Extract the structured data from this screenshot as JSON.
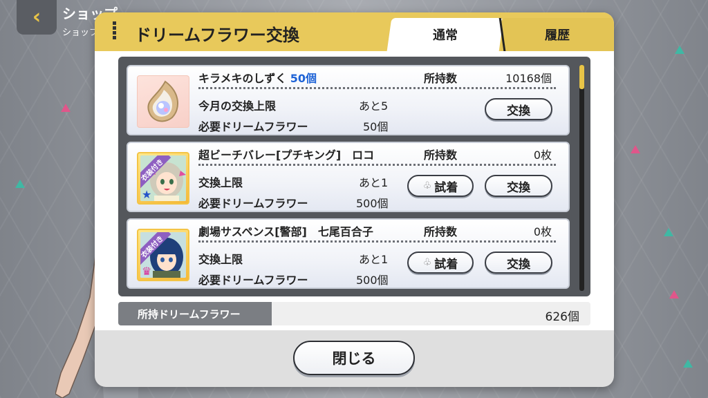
{
  "shop": {
    "title": "ショップ",
    "subtitle": "ショップ"
  },
  "modal": {
    "title": "ドリームフラワー交換",
    "tabs": [
      {
        "label": "通常",
        "active": true
      },
      {
        "label": "履歴",
        "active": false
      }
    ]
  },
  "items": [
    {
      "name": "キラメキのしずく",
      "quantity": "50個",
      "owned_label": "所持数",
      "owned_value": "10168個",
      "limit_label": "今月の交換上限",
      "limit_value": "あと5",
      "cost_label": "必要ドリームフラワー",
      "cost_value": "50個",
      "exchange_label": "交換",
      "icon": "crystal-drop-icon"
    },
    {
      "name": "超ビーチバレー[プチキング]　ロコ",
      "owned_label": "所持数",
      "owned_value": "0枚",
      "limit_label": "交換上限",
      "limit_value": "あと1",
      "cost_label": "必要ドリームフラワー",
      "cost_value": "500個",
      "try_label": "試着",
      "exchange_label": "交換",
      "badge": "衣装付き",
      "icon": "idol-card-icon"
    },
    {
      "name": "劇場サスペンス[警部]　七尾百合子",
      "owned_label": "所持数",
      "owned_value": "0枚",
      "limit_label": "交換上限",
      "limit_value": "あと1",
      "cost_label": "必要ドリームフラワー",
      "cost_value": "500個",
      "try_label": "試着",
      "exchange_label": "交換",
      "badge": "衣装付き",
      "icon": "idol-card-icon"
    }
  ],
  "owned_flowers": {
    "label": "所持ドリームフラワー",
    "value": "626個"
  },
  "close_label": "閉じる",
  "colors": {
    "header": "#e8c95b",
    "accent": "#e8c447",
    "number_blue": "#1e63d6"
  }
}
